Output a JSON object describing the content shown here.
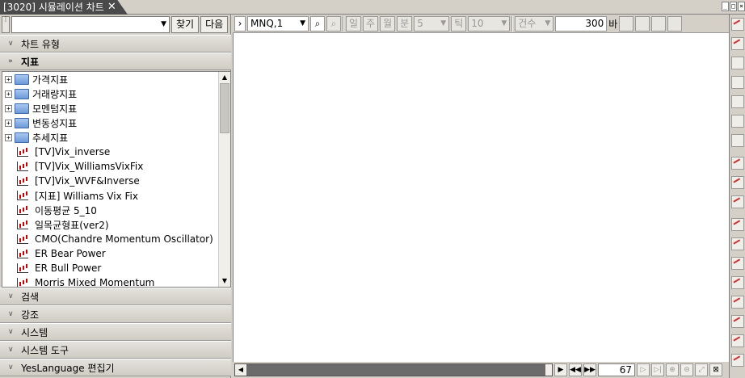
{
  "window": {
    "tab_title": "[3020] 시뮬레이션 차트",
    "close_glyph": "✕",
    "controls": [
      "_",
      "□",
      "×"
    ]
  },
  "left_panel": {
    "search_value": "",
    "find_button": "찾기",
    "next_button": "다음",
    "sections_top": [
      {
        "label": "차트 유형",
        "expanded": false
      },
      {
        "label": "지표",
        "expanded": true
      }
    ],
    "tree": {
      "folders": [
        "가격지표",
        "거래량지표",
        "모멘텀지표",
        "변동성지표",
        "추세지표"
      ],
      "items": [
        "[TV]Vix_inverse",
        "[TV]Vix_WilliamsVixFix",
        "[TV]Vix_WVF&Inverse",
        "[지표] Williams Vix Fix",
        "이동평균 5_10",
        "일목균형표(ver2)",
        "CMO(Chandre Momentum Oscillator)",
        "ER Bear Power",
        "ER Bull Power",
        "Morris Mixed Momentum"
      ]
    },
    "sections_bottom": [
      "검색",
      "강조",
      "시스템",
      "시스템 도구",
      "YesLanguage 편집기"
    ]
  },
  "toolbar": {
    "symbol": "MNQ,1",
    "period_buttons": [
      "일",
      "주",
      "월",
      "분"
    ],
    "minute_value": "5",
    "tick_label": "틱",
    "tick_value": "10",
    "count_select": "건수",
    "count_value": "300",
    "count_unit": "바"
  },
  "bottom": {
    "zoom_value": "67"
  },
  "colors": {
    "panel_bg": "#d4d0c8",
    "tab_bg": "#4a4a4a",
    "chart_bg": "#ffffff"
  }
}
